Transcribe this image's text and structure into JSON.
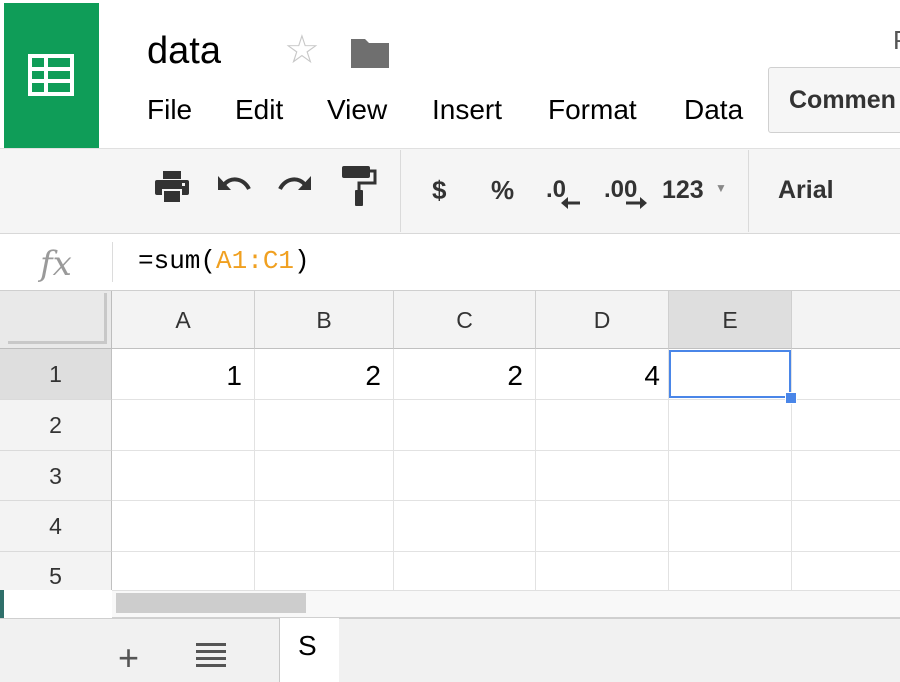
{
  "header": {
    "doc_title": "data",
    "star_icon": "star-outline-icon",
    "folder_icon": "folder-icon",
    "share_partial": "P",
    "comments_label": "Commen"
  },
  "menu": {
    "items": [
      "File",
      "Edit",
      "View",
      "Insert",
      "Format",
      "Data"
    ]
  },
  "toolbar": {
    "icons": [
      "print-icon",
      "undo-icon",
      "redo-icon",
      "paint-format-icon"
    ],
    "currency_label": "$",
    "percent_label": "%",
    "decrease_decimal_label": ".0",
    "increase_decimal_label": ".00",
    "more_formats_label": "123",
    "font_label": "Arial"
  },
  "formula_bar": {
    "fx_label": "fx",
    "formula_prefix": "=sum(",
    "formula_range": "A1:C1",
    "formula_suffix": ")"
  },
  "grid": {
    "columns": [
      "A",
      "B",
      "C",
      "D",
      "E"
    ],
    "rows": [
      "1",
      "2",
      "3",
      "4",
      "5"
    ],
    "cells": {
      "A1": "1",
      "B1": "2",
      "C1": "2",
      "D1": "4"
    },
    "selected_cell": "E1"
  },
  "sheet_bar": {
    "add_icon": "plus-icon",
    "list_icon": "list-icon",
    "tab_label": "S"
  },
  "colors": {
    "brand_green": "#0f9d58",
    "selection_blue": "#4a86e8",
    "range_orange": "#f0a020"
  }
}
